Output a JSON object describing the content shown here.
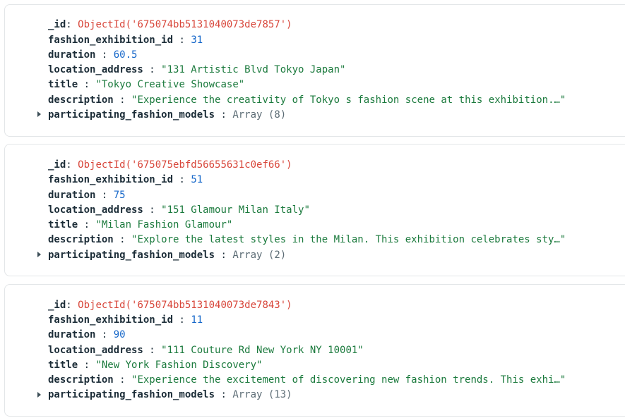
{
  "documents": [
    {
      "id_key": "_id",
      "id_value": "ObjectId('675074bb5131040073de7857')",
      "fashion_exhibition_id_key": "fashion_exhibition_id",
      "fashion_exhibition_id": "31",
      "duration_key": "duration",
      "duration": "60.5",
      "location_address_key": "location_address",
      "location_address": "\"131 Artistic Blvd Tokyo Japan\"",
      "title_key": "title",
      "title": "\"Tokyo Creative Showcase\"",
      "description_key": "description",
      "description": "\"Experience the creativity of Tokyos fashion scene at this exhibition.…\"",
      "models_key": "participating_fashion_models",
      "models": "Array (8)"
    },
    {
      "id_key": "_id",
      "id_value": "ObjectId('675075ebfd56655631c0ef66')",
      "fashion_exhibition_id_key": "fashion_exhibition_id",
      "fashion_exhibition_id": "51",
      "duration_key": "duration",
      "duration": "75",
      "location_address_key": "location_address",
      "location_address": "\"151 Glamour Milan Italy\"",
      "title_key": "title",
      "title": "\"Milan Fashion Glamour\"",
      "description_key": "description",
      "description": "\"Explore the latest styles in the Milan. This exhibition celebrates sty…\"",
      "models_key": "participating_fashion_models",
      "models": "Array (2)"
    },
    {
      "id_key": "_id",
      "id_value": "ObjectId('675074bb5131040073de7843')",
      "fashion_exhibition_id_key": "fashion_exhibition_id",
      "fashion_exhibition_id": "11",
      "duration_key": "duration",
      "duration": "90",
      "location_address_key": "location_address",
      "location_address": "\"111 Couture Rd New York NY 10001\"",
      "title_key": "title",
      "title": "\"New York Fashion Discovery\"",
      "description_key": "description",
      "description": "\"Experience the excitement of discovering new fashion trends. This exhi…\"",
      "models_key": "participating_fashion_models",
      "models": "Array (13)"
    }
  ]
}
